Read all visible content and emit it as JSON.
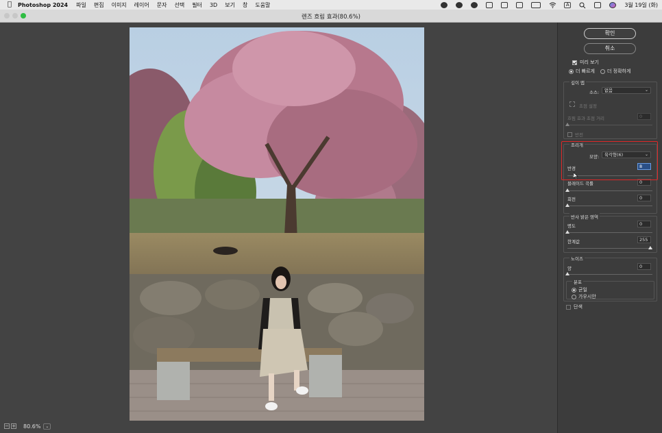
{
  "menubar": {
    "app": "Photoshop 2024",
    "items": [
      "파일",
      "편집",
      "이미지",
      "레이어",
      "문자",
      "선택",
      "필터",
      "3D",
      "보기",
      "창",
      "도움말"
    ],
    "clock": "3월 19일 (화)",
    "input_indicator": "A"
  },
  "window": {
    "title": "렌즈 흐림 효과(80.6%)"
  },
  "status": {
    "zoom": "80.6%"
  },
  "panel": {
    "ok": "확인",
    "cancel": "취소",
    "preview": "미리 보기",
    "faster": "더 빠르게",
    "accurate": "더 정확하게",
    "depth_map": {
      "title": "깊이 맵",
      "source_label": "소스:",
      "source_value": "없음",
      "blur_focus": "초점 설정",
      "blur_distance": "흐림 효과 초점 거리",
      "blur_distance_value": "0",
      "invert": "반전"
    },
    "iris": {
      "title": "조리개",
      "shape_label": "모양:",
      "shape_value": "육각형(6)",
      "radius_label": "반경",
      "radius_value": "8",
      "blade_label": "블레이드 곡률",
      "blade_value": "0",
      "rotation_label": "회전",
      "rotation_value": "0"
    },
    "specular": {
      "title": "반사 밝은 영역",
      "brightness_label": "명도",
      "brightness_value": "0",
      "threshold_label": "한계값",
      "threshold_value": "255"
    },
    "noise": {
      "title": "노이즈",
      "amount_label": "양",
      "amount_value": "0",
      "dist_title": "분포",
      "uniform": "균일",
      "gaussian": "가우시안",
      "mono": "단색"
    }
  }
}
